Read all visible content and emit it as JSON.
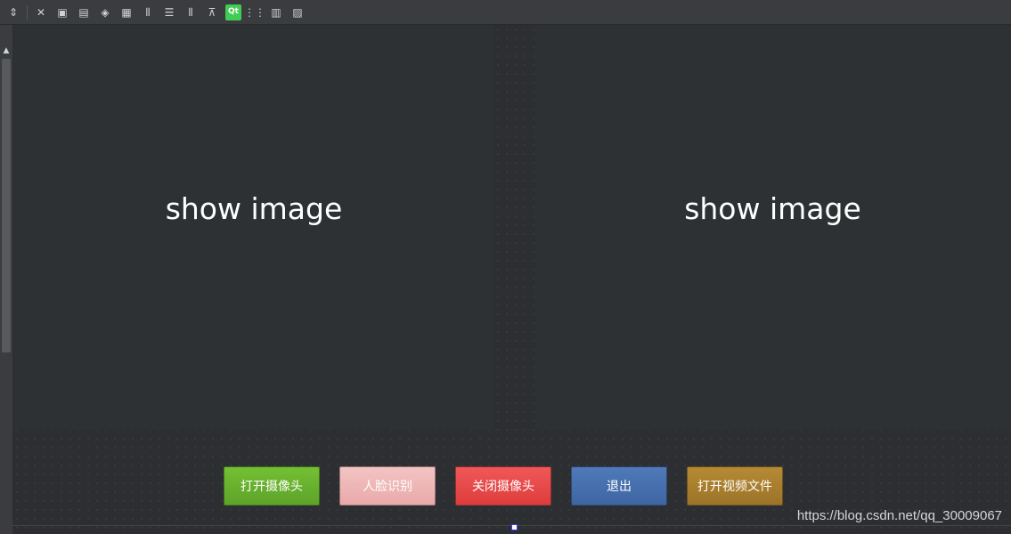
{
  "toolbar": {
    "icons": [
      "sort-arrows-icon",
      "close-icon",
      "widget-box-icon",
      "widget-box-alt-icon",
      "tag-icon",
      "form-icon",
      "vertical-bars-icon",
      "horizontal-lines-icon",
      "split-horizontal-icon",
      "split-vertical-icon",
      "qt-logo-icon",
      "grid-icon",
      "layout-form-icon",
      "image-icon"
    ],
    "qt_label": "Qt"
  },
  "panels": {
    "left_label": "show image",
    "right_label": "show image"
  },
  "buttons": {
    "open_camera": "打开摄像头",
    "face_recognition": "人脸识别",
    "close_camera": "关闭摄像头",
    "exit": "退出",
    "open_video": "打开视频文件"
  },
  "watermark": "https://blog.csdn.net/qq_30009067",
  "colors": {
    "open_camera": "#6bb42f",
    "face_recognition": "#eeb7b7",
    "close_camera": "#e84a4a",
    "exit": "#4770ad",
    "open_video": "#a98030"
  }
}
